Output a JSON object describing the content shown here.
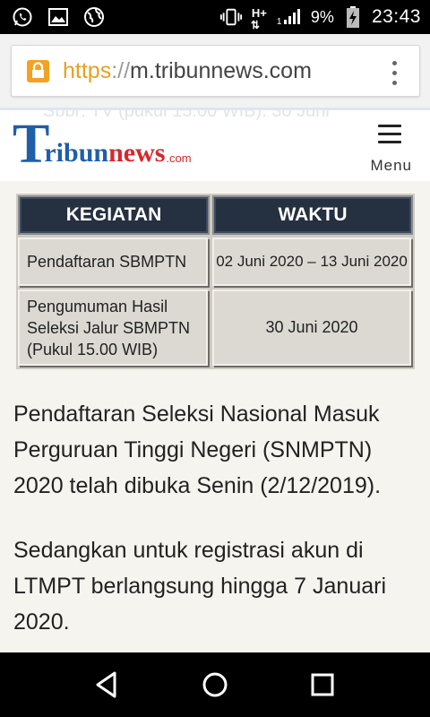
{
  "status_bar": {
    "left_icons": [
      "whatsapp-icon",
      "image-icon",
      "globe-icon"
    ],
    "network_label": "H+",
    "network_sub": "1",
    "battery_percent": "9%",
    "time": "23:43"
  },
  "browser": {
    "url_scheme": "https",
    "url_separator": "://",
    "url_host": "m.tribunnews.com"
  },
  "site_header": {
    "logo_t": "T",
    "logo_ribun": "ribun",
    "logo_news": "news",
    "logo_com": ".com",
    "menu_label": "Menu",
    "ghost_text": "Sbbr: TV (pukul 15.00 WIB). 30 Juni"
  },
  "table": {
    "headers": [
      "KEGIATAN",
      "WAKTU"
    ],
    "rows": [
      {
        "kegiatan": "Pendaftaran SBMPTN",
        "waktu": "02 Juni 2020 – 13 Juni 2020"
      },
      {
        "kegiatan_lines": [
          "Pengumuman Hasil",
          "Seleksi Jalur SBMPTN",
          "(Pukul 15.00 WIB)"
        ],
        "waktu": "30 Juni 2020"
      }
    ]
  },
  "article": {
    "paragraphs": [
      "Pendaftaran Seleksi Nasional Masuk Perguruan Tinggi Negeri (SNMPTN) 2020 telah dibuka Senin (2/12/2019).",
      "Sedangkan untuk registrasi akun di LTMPT berlangsung hingga 7 Januari 2020."
    ]
  },
  "nav_bar": {
    "buttons": [
      "back-icon",
      "home-icon",
      "recents-icon"
    ]
  }
}
